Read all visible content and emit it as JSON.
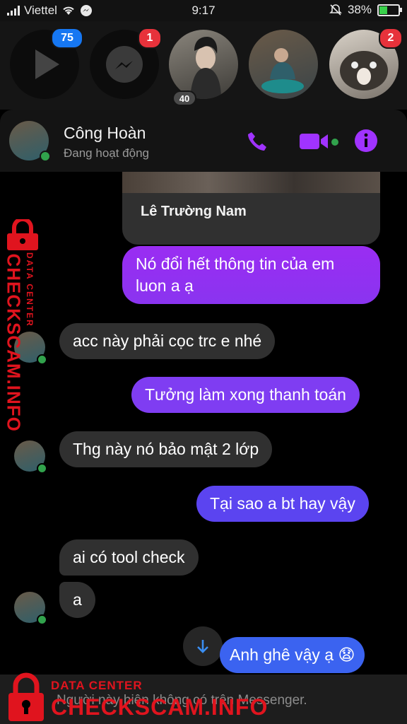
{
  "statusbar": {
    "carrier": "Viettel",
    "time": "9:17",
    "battery": "38%",
    "battery_level": 0.38
  },
  "chat_heads": {
    "badge_app": "75",
    "badge_messenger": "1",
    "badge_friend": "2",
    "under_badge": "40"
  },
  "header": {
    "name": "Công Hoàn",
    "status": "Đang hoạt động"
  },
  "shared_card": {
    "name": "Lê Trường Nam"
  },
  "messages": [
    {
      "dir": "out",
      "text": "Nó đổi hết thông tin của em",
      "text2": "luon a ạ"
    },
    {
      "dir": "in",
      "text": "acc này phải cọc trc e nhé"
    },
    {
      "dir": "out",
      "text": "Tưởng làm xong thanh toán"
    },
    {
      "dir": "in",
      "text": "Thg này nó bảo mật 2 lớp"
    },
    {
      "dir": "out",
      "text": "Tại sao a bt hay vậy"
    },
    {
      "dir": "in",
      "text": "ai có tool check"
    },
    {
      "dir": "in",
      "text": "a"
    },
    {
      "dir": "out",
      "text": "Anh ghê vậy ạ 😧"
    }
  ],
  "footer": {
    "notice": "Người này hiện không có trên Messenger."
  },
  "watermark": {
    "label": "DATA CENTER",
    "site": "CHECKSCAM.INFO"
  },
  "colors": {
    "accent": "#a033ff",
    "bubble_in": "#303030",
    "online": "#31a24c"
  }
}
